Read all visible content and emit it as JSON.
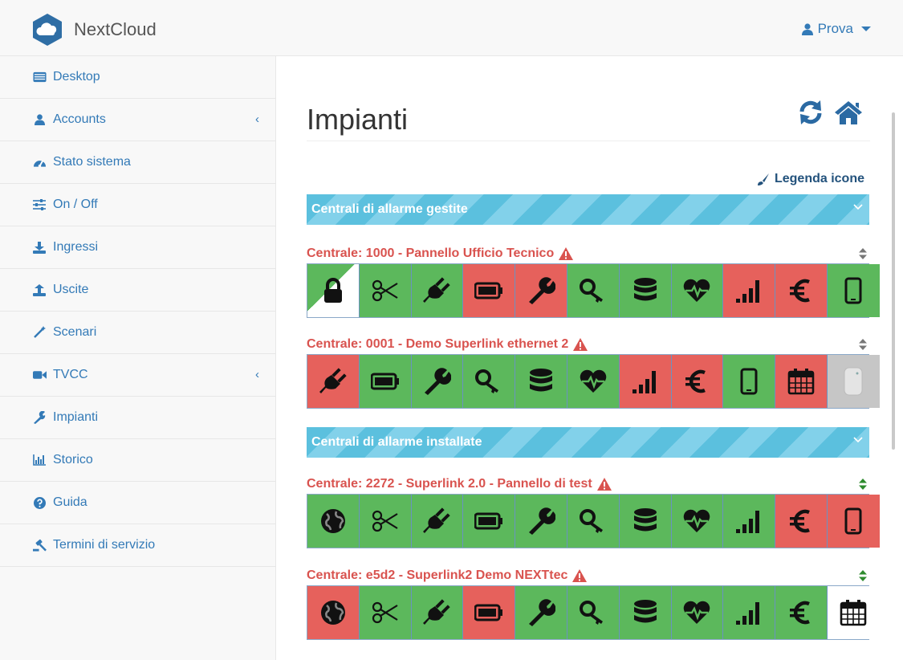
{
  "navbar": {
    "brand": "NextCloud",
    "user": "Prova"
  },
  "sidebar": {
    "items": [
      {
        "label": "Desktop",
        "icon": "desktop-icon",
        "has_chevron": false
      },
      {
        "label": "Accounts",
        "icon": "user-icon",
        "has_chevron": true
      },
      {
        "label": "Stato sistema",
        "icon": "dashboard-icon",
        "has_chevron": false
      },
      {
        "label": "On / Off",
        "icon": "sliders-icon",
        "has_chevron": false
      },
      {
        "label": "Ingressi",
        "icon": "download-icon",
        "has_chevron": false
      },
      {
        "label": "Uscite",
        "icon": "upload-icon",
        "has_chevron": false
      },
      {
        "label": "Scenari",
        "icon": "magic-wand-icon",
        "has_chevron": false
      },
      {
        "label": "TVCC",
        "icon": "video-camera-icon",
        "has_chevron": true
      },
      {
        "label": "Impianti",
        "icon": "wrench-icon",
        "has_chevron": false
      },
      {
        "label": "Storico",
        "icon": "bar-chart-icon",
        "has_chevron": false
      },
      {
        "label": "Guida",
        "icon": "question-circle-icon",
        "has_chevron": false
      },
      {
        "label": "Termini di servizio",
        "icon": "gavel-icon",
        "has_chevron": false
      }
    ],
    "chevron": "‹"
  },
  "main": {
    "title": "Impianti",
    "legend_link": "Legenda icone",
    "groups": [
      {
        "label": "Centrali di allarme gestite"
      },
      {
        "label": "Centrali di allarme installate"
      }
    ],
    "centrals": [
      {
        "label": "Centrale: 1000 - Pannello Ufficio Tecnico",
        "sort_color": "#777777",
        "tiles": [
          {
            "icon": "lock-icon",
            "state": "split"
          },
          {
            "icon": "scissors-icon",
            "state": "g"
          },
          {
            "icon": "plug-icon",
            "state": "g"
          },
          {
            "icon": "battery-icon",
            "state": "r"
          },
          {
            "icon": "wrench-icon",
            "state": "r"
          },
          {
            "icon": "key-icon",
            "state": "g"
          },
          {
            "icon": "database-icon",
            "state": "g"
          },
          {
            "icon": "heartbeat-icon",
            "state": "g"
          },
          {
            "icon": "signal-icon",
            "state": "r"
          },
          {
            "icon": "euro-icon",
            "state": "r"
          },
          {
            "icon": "mobile-icon",
            "state": "g"
          }
        ]
      },
      {
        "label": "Centrale: 0001 - Demo Superlink ethernet 2",
        "sort_color": "#777777",
        "tiles": [
          {
            "icon": "plug-icon",
            "state": "r"
          },
          {
            "icon": "battery-icon",
            "state": "g"
          },
          {
            "icon": "wrench-icon",
            "state": "g"
          },
          {
            "icon": "key-icon",
            "state": "g"
          },
          {
            "icon": "database-icon",
            "state": "g"
          },
          {
            "icon": "heartbeat-icon",
            "state": "g"
          },
          {
            "icon": "signal-icon",
            "state": "r"
          },
          {
            "icon": "euro-icon",
            "state": "r"
          },
          {
            "icon": "mobile-icon",
            "state": "g"
          },
          {
            "icon": "calendar-icon",
            "state": "r"
          },
          {
            "icon": "device-icon",
            "state": "gray"
          }
        ]
      },
      {
        "label": "Centrale: 2272 - Superlink 2.0 - Pannello di test",
        "sort_color": "#2e8b2e",
        "tiles": [
          {
            "icon": "globe-icon",
            "state": "g"
          },
          {
            "icon": "scissors-icon",
            "state": "g"
          },
          {
            "icon": "plug-icon",
            "state": "g"
          },
          {
            "icon": "battery-icon",
            "state": "g"
          },
          {
            "icon": "wrench-icon",
            "state": "g"
          },
          {
            "icon": "key-icon",
            "state": "g"
          },
          {
            "icon": "database-icon",
            "state": "g"
          },
          {
            "icon": "heartbeat-icon",
            "state": "g"
          },
          {
            "icon": "signal-icon",
            "state": "g"
          },
          {
            "icon": "euro-icon",
            "state": "r"
          },
          {
            "icon": "mobile-icon",
            "state": "r"
          }
        ]
      },
      {
        "label": "Centrale: e5d2 - Superlink2 Demo NEXTtec",
        "sort_color": "#2e8b2e",
        "tiles": [
          {
            "icon": "globe-icon",
            "state": "r"
          },
          {
            "icon": "scissors-icon",
            "state": "g"
          },
          {
            "icon": "plug-icon",
            "state": "g"
          },
          {
            "icon": "battery-icon",
            "state": "r"
          },
          {
            "icon": "wrench-icon",
            "state": "g"
          },
          {
            "icon": "key-icon",
            "state": "g"
          },
          {
            "icon": "database-icon",
            "state": "g"
          },
          {
            "icon": "heartbeat-icon",
            "state": "g"
          },
          {
            "icon": "signal-icon",
            "state": "g"
          },
          {
            "icon": "euro-icon",
            "state": "g"
          },
          {
            "icon": "calendar-icon",
            "state": "w"
          }
        ]
      }
    ]
  },
  "colors": {
    "ok": "#5cb85c",
    "alert": "#e6615c",
    "link": "#337ab7",
    "warning_text": "#d9534f",
    "group_bar": "#5bc0de"
  }
}
